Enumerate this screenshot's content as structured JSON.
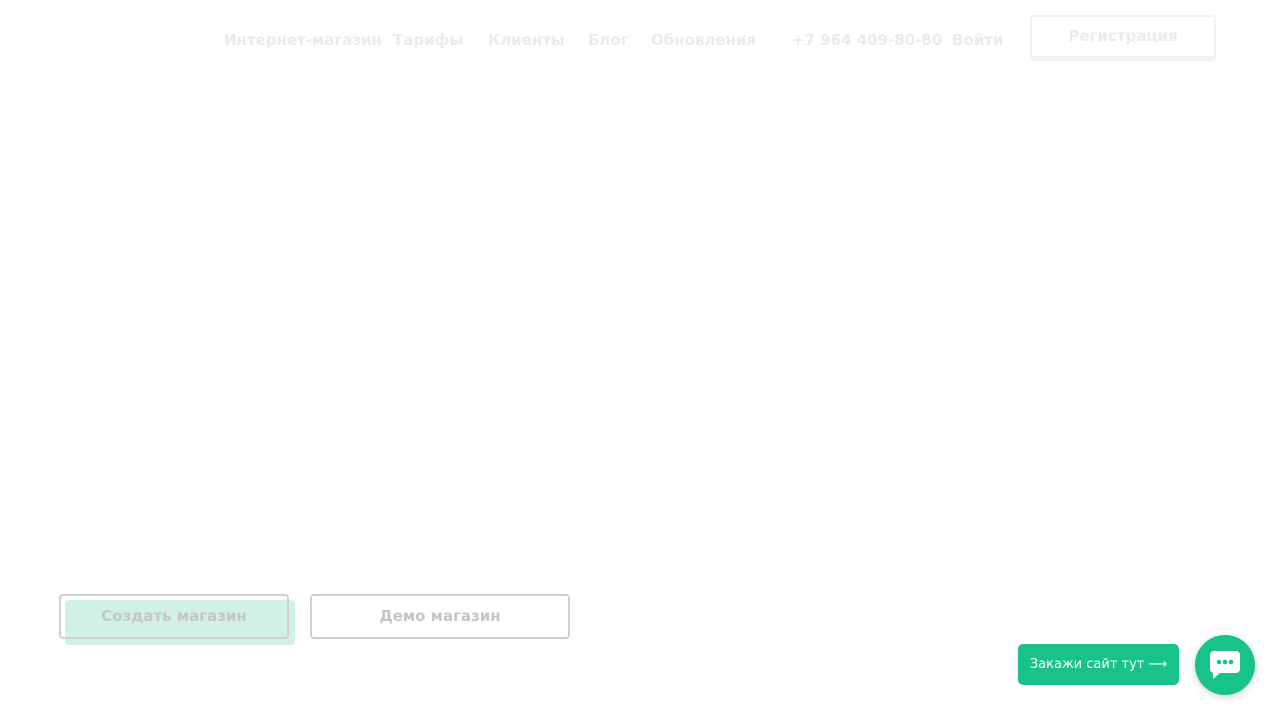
{
  "header": {
    "nav": [
      {
        "label": "Интернет-магазин"
      },
      {
        "label": "Тарифы"
      },
      {
        "label": "Клиенты"
      },
      {
        "label": "Блог"
      },
      {
        "label": "Обновления"
      }
    ],
    "phone": "+7 964 409-80-80",
    "login_label": "Войти",
    "register_label": "Регистрация"
  },
  "hero": {
    "create_label": "Создать магазин",
    "demo_label": "Демо магазин"
  },
  "widget": {
    "order_label": "Закажи сайт тут ⟶",
    "chat_icon": "chat-bubble-icon",
    "accent_color": "#17c38a"
  }
}
